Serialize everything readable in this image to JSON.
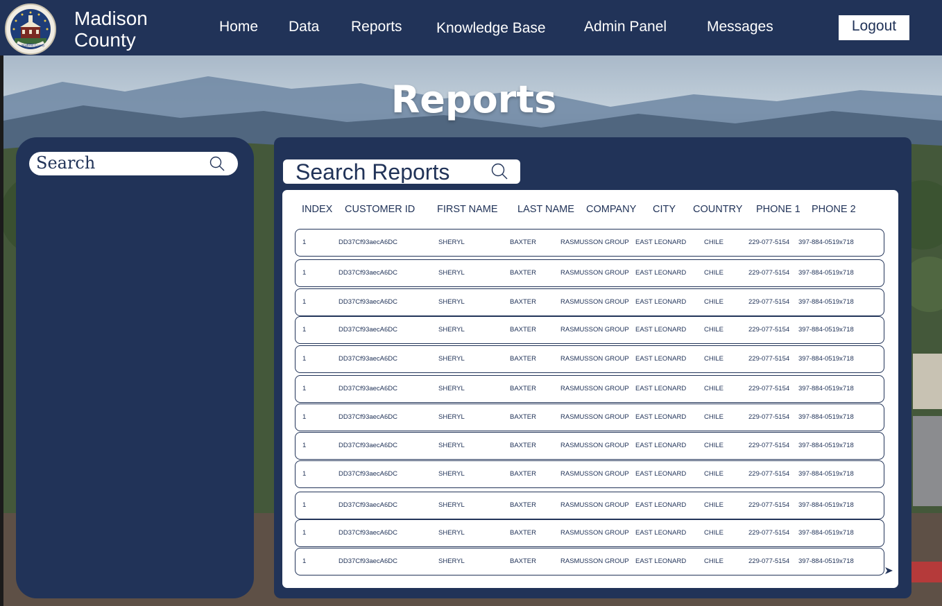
{
  "header": {
    "brand_line1": "Madison",
    "brand_line2": "County",
    "seal_text": "Madison County",
    "nav": [
      "Home",
      "Data",
      "Reports",
      "Knowledge Base",
      "Admin Panel",
      "Messages"
    ],
    "logout_label": "Logout"
  },
  "page": {
    "title": "Reports"
  },
  "sidebar": {
    "search_placeholder": "Search"
  },
  "reports": {
    "search_placeholder": "Search Reports",
    "columns": [
      "INDEX",
      "CUSTOMER ID",
      "FIRST NAME",
      "LAST NAME",
      "COMPANY",
      "CITY",
      "COUNTRY",
      "PHONE 1",
      "PHONE 2"
    ],
    "rows": [
      [
        "1",
        "DD37Cf93aecA6DC",
        "SHERYL",
        "BAXTER",
        "RASMUSSON GROUP",
        "EAST LEONARD",
        "CHILE",
        "229-077-5154",
        "397-884-0519x718"
      ],
      [
        "1",
        "DD37Cf93aecA6DC",
        "SHERYL",
        "BAXTER",
        "RASMUSSON GROUP",
        "EAST LEONARD",
        "CHILE",
        "229-077-5154",
        "397-884-0519x718"
      ],
      [
        "1",
        "DD37Cf93aecA6DC",
        "SHERYL",
        "BAXTER",
        "RASMUSSON GROUP",
        "EAST LEONARD",
        "CHILE",
        "229-077-5154",
        "397-884-0519x718"
      ],
      [
        "1",
        "DD37Cf93aecA6DC",
        "SHERYL",
        "BAXTER",
        "RASMUSSON GROUP",
        "EAST LEONARD",
        "CHILE",
        "229-077-5154",
        "397-884-0519x718"
      ],
      [
        "1",
        "DD37Cf93aecA6DC",
        "SHERYL",
        "BAXTER",
        "RASMUSSON GROUP",
        "EAST LEONARD",
        "CHILE",
        "229-077-5154",
        "397-884-0519x718"
      ],
      [
        "1",
        "DD37Cf93aecA6DC",
        "SHERYL",
        "BAXTER",
        "RASMUSSON GROUP",
        "EAST LEONARD",
        "CHILE",
        "229-077-5154",
        "397-884-0519x718"
      ],
      [
        "1",
        "DD37Cf93aecA6DC",
        "SHERYL",
        "BAXTER",
        "RASMUSSON GROUP",
        "EAST LEONARD",
        "CHILE",
        "229-077-5154",
        "397-884-0519x718"
      ],
      [
        "1",
        "DD37Cf93aecA6DC",
        "SHERYL",
        "BAXTER",
        "RASMUSSON GROUP",
        "EAST LEONARD",
        "CHILE",
        "229-077-5154",
        "397-884-0519x718"
      ],
      [
        "1",
        "DD37Cf93aecA6DC",
        "SHERYL",
        "BAXTER",
        "RASMUSSON GROUP",
        "EAST LEONARD",
        "CHILE",
        "229-077-5154",
        "397-884-0519x718"
      ],
      [
        "1",
        "DD37Cf93aecA6DC",
        "SHERYL",
        "BAXTER",
        "RASMUSSON GROUP",
        "EAST LEONARD",
        "CHILE",
        "229-077-5154",
        "397-884-0519x718"
      ],
      [
        "1",
        "DD37Cf93aecA6DC",
        "SHERYL",
        "BAXTER",
        "RASMUSSON GROUP",
        "EAST LEONARD",
        "CHILE",
        "229-077-5154",
        "397-884-0519x718"
      ],
      [
        "1",
        "DD37Cf93aecA6DC",
        "SHERYL",
        "BAXTER",
        "RASMUSSON GROUP",
        "EAST LEONARD",
        "CHILE",
        "229-077-5154",
        "397-884-0519x718"
      ]
    ]
  },
  "icons": {
    "sidebar_search": "search-icon",
    "reports_search": "search-icon",
    "pagination": "next-page-icon",
    "logo": "county-seal-icon"
  },
  "colors": {
    "navy": "#213358",
    "white": "#ffffff"
  }
}
